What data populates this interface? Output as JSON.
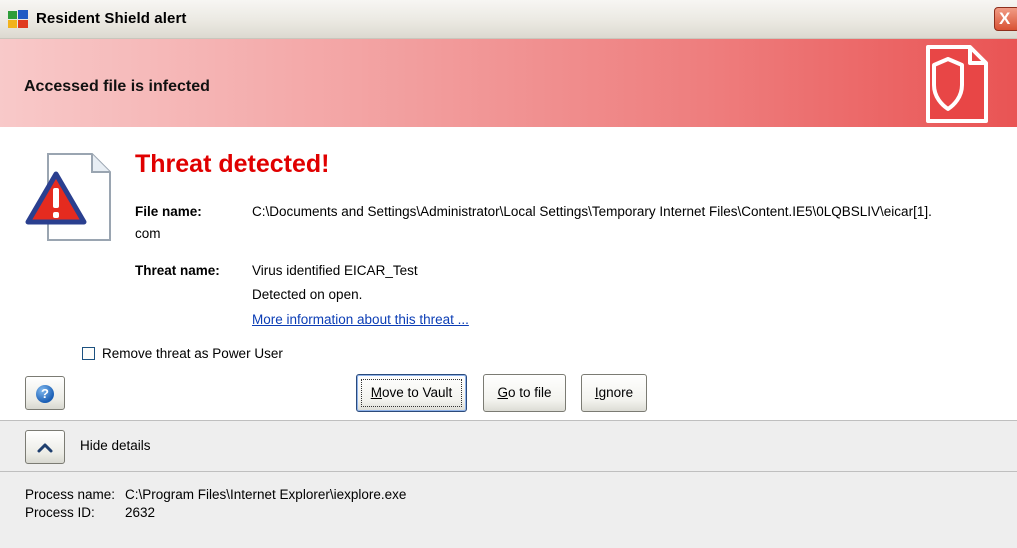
{
  "window": {
    "title": "Resident Shield alert",
    "close_glyph": "X"
  },
  "banner": {
    "text": "Accessed file is infected",
    "icon": "shield-document-icon"
  },
  "threat": {
    "title": "Threat detected!",
    "file_label": "File name:",
    "file_value": "C:\\Documents and Settings\\Administrator\\Local Settings\\Temporary Internet Files\\Content.IE5\\0LQBSLIV\\eicar[1].",
    "file_value_cont": "com",
    "threat_label": "Threat name:",
    "threat_value": "Virus identified EICAR_Test",
    "detected_text": "Detected on open.",
    "more_info_link": "More information about this threat ..."
  },
  "options": {
    "power_user_label": "Remove threat as Power User",
    "power_user_checked": false
  },
  "buttons": {
    "help_glyph": "?",
    "move_to_vault": {
      "prefix": "",
      "accel": "M",
      "suffix": "ove to Vault"
    },
    "go_to_file": {
      "prefix": "",
      "accel": "G",
      "suffix": "o to file"
    },
    "ignore": {
      "prefix": "",
      "accel": "I",
      "suffix": "gnore"
    }
  },
  "details": {
    "toggle_label": "Hide details",
    "process_name_label": "Process name:",
    "process_name_value": "C:\\Program Files\\Internet Explorer\\iexplore.exe",
    "process_id_label": "Process ID:",
    "process_id_value": "2632"
  },
  "colors": {
    "threat_title": "#e00000",
    "banner_start": "#f8c9c9",
    "banner_end": "#e95454",
    "link": "#0b3db5",
    "details_bg": "#eeeeee"
  }
}
